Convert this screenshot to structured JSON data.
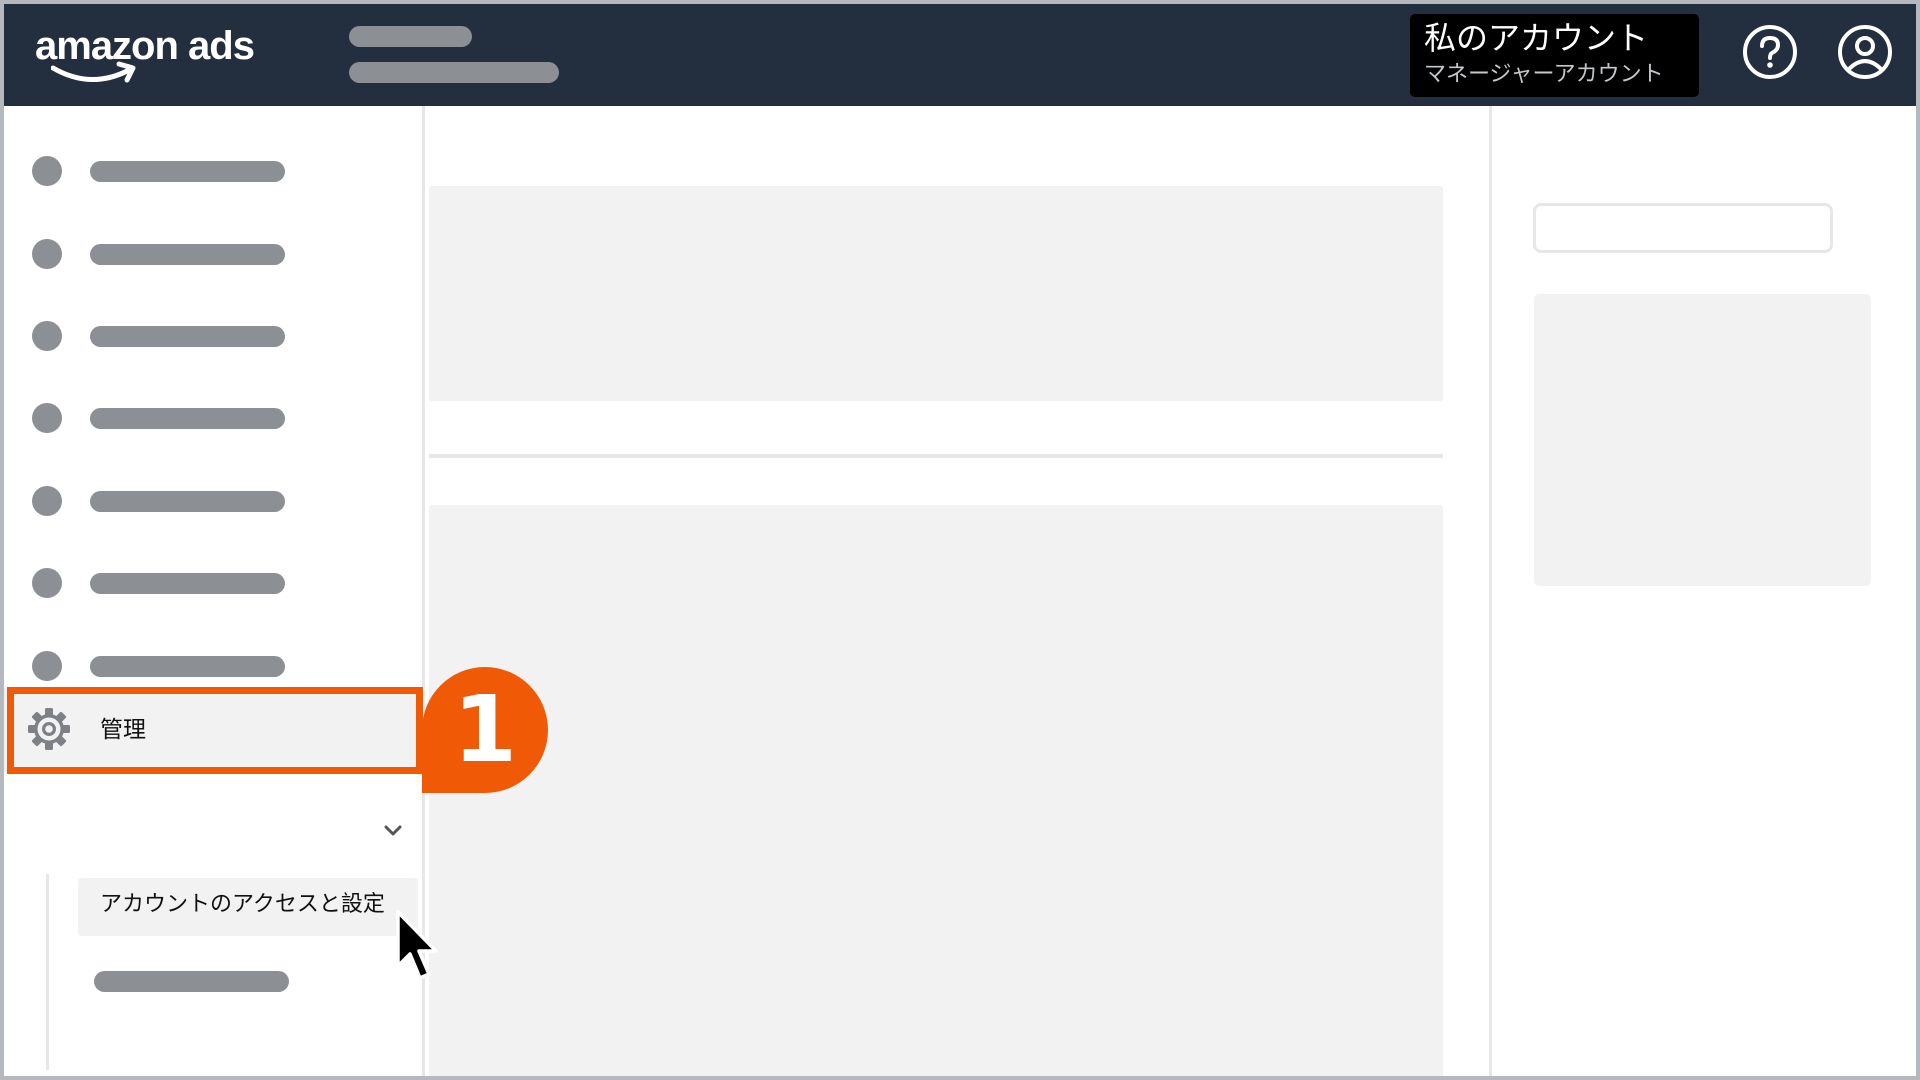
{
  "header": {
    "logo_text": "amazon ads",
    "account": {
      "title": "私のアカウント",
      "subtitle": "マネージャーアカウント"
    },
    "icons": [
      "help-icon",
      "user-account-icon"
    ]
  },
  "sidebar": {
    "admin": {
      "label": "管理",
      "icon": "gear-icon",
      "expanded": true,
      "subitems": [
        {
          "label": "アカウントのアクセスと設定"
        }
      ]
    }
  },
  "step_badge": {
    "number": "1"
  },
  "colors": {
    "topbar": "#232f3e",
    "highlight": "#f05a06",
    "placeholder": "#8c9095",
    "panel": "#f2f2f2"
  }
}
